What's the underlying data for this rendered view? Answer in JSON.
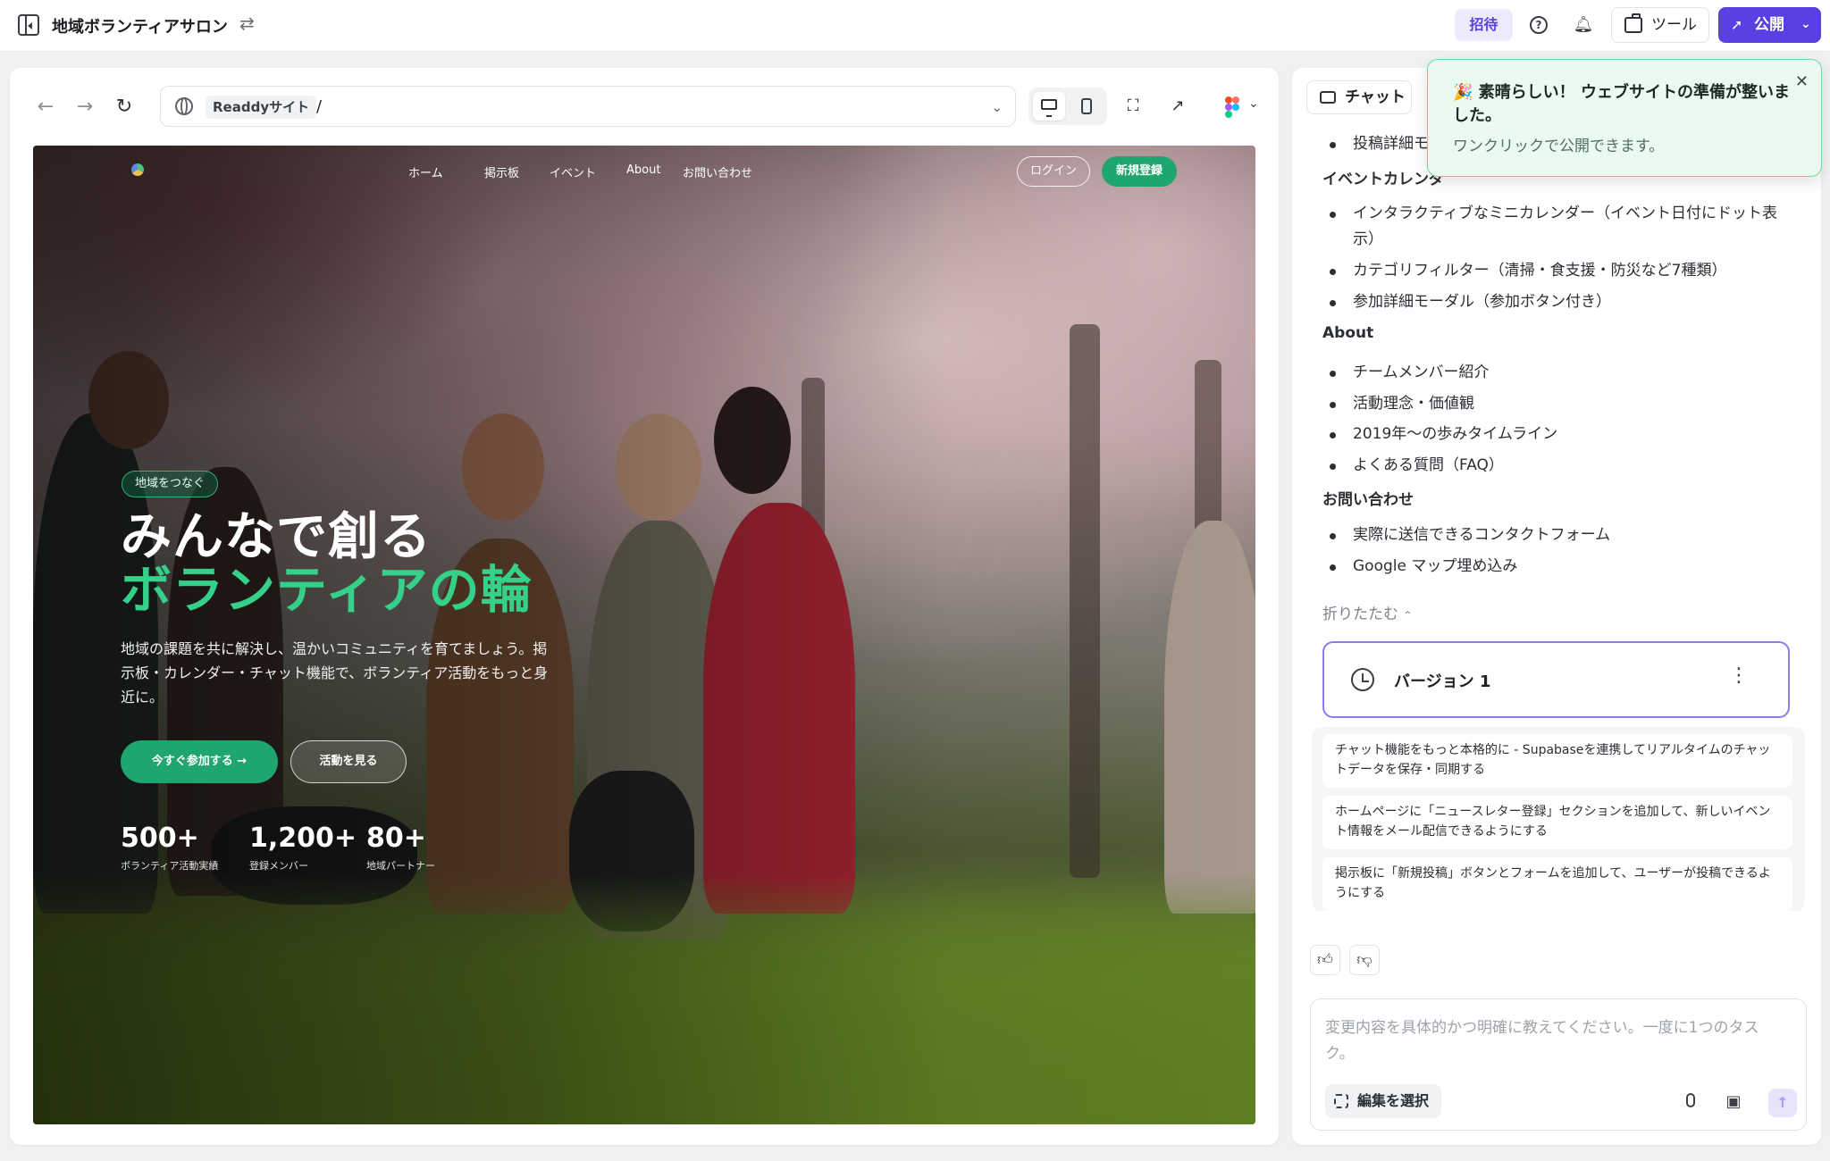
{
  "topbar": {
    "project_title": "地域ボランティアサロン",
    "invite_label": "招待",
    "tools_label": "ツール",
    "publish_label": "公開"
  },
  "preview": {
    "url_site": "Readdyサイト",
    "url_path": "/"
  },
  "site": {
    "nav": [
      "ホーム",
      "掲示板",
      "イベント",
      "About",
      "お問い合わせ"
    ],
    "login_label": "ログイン",
    "signup_label": "新規登録",
    "badge": "地域をつなぐ",
    "headline_1": "みんなで創る",
    "headline_2": "ボランティアの輪",
    "description": "地域の課題を共に解決し、温かいコミュニティを育てましょう。掲示板・カレンダー・チャット機能で、ボランティア活動をもっと身近に。",
    "join_label": "今すぐ参加する →",
    "activity_label": "活動を見る",
    "stats": [
      {
        "value": "500+",
        "label": "ボランティア活動実績"
      },
      {
        "value": "1,200+",
        "label": "登録メンバー"
      },
      {
        "value": "80+",
        "label": "地域パートナー"
      }
    ]
  },
  "panel": {
    "chat_tab": "チャット",
    "lines": {
      "l0": "投稿詳細モ",
      "h1": "イベントカレンダ",
      "l1a": "インタラクティブなミニカレンダー（イベント日付にドット表",
      "l1a2": "示）",
      "l1b": "カテゴリフィルター（清掃・食支援・防災など7種類）",
      "l1c": "参加詳細モーダル（参加ボタン付き）",
      "h2": "About",
      "l2a": "チームメンバー紹介",
      "l2b": "活動理念・価値観",
      "l2c": "2019年〜の歩みタイムライン",
      "l2d": "よくある質問（FAQ）",
      "h3": "お問い合わせ",
      "l3a": "実際に送信できるコンタクトフォーム",
      "l3b": "Google マップ埋め込み"
    },
    "collapse_label": "折りたたむ",
    "version_label": "バージョン 1",
    "suggestions": [
      "チャット機能をもっと本格的に - Supabaseを連携してリアルタイムのチャットデータを保存・同期する",
      "ホームページに「ニュースレター登録」セクションを追加して、新しいイベント情報をメール配信できるようにする",
      "掲示板に「新規投稿」ボタンとフォームを追加して、ユーザーが投稿できるようにする"
    ],
    "composer_placeholder": "変更内容を具体的かつ明確に教えてください。一度に1つのタスク。",
    "edit_select_label": "編集を選択"
  },
  "toast": {
    "title": "🎉 素晴らしい！ ウェブサイトの準備が整いました。",
    "subtitle": "ワンクリックで公開できます。"
  },
  "colors": {
    "accent": "#5b3fe0",
    "site_green": "#1fa56e",
    "headline_green": "#35d08a"
  }
}
